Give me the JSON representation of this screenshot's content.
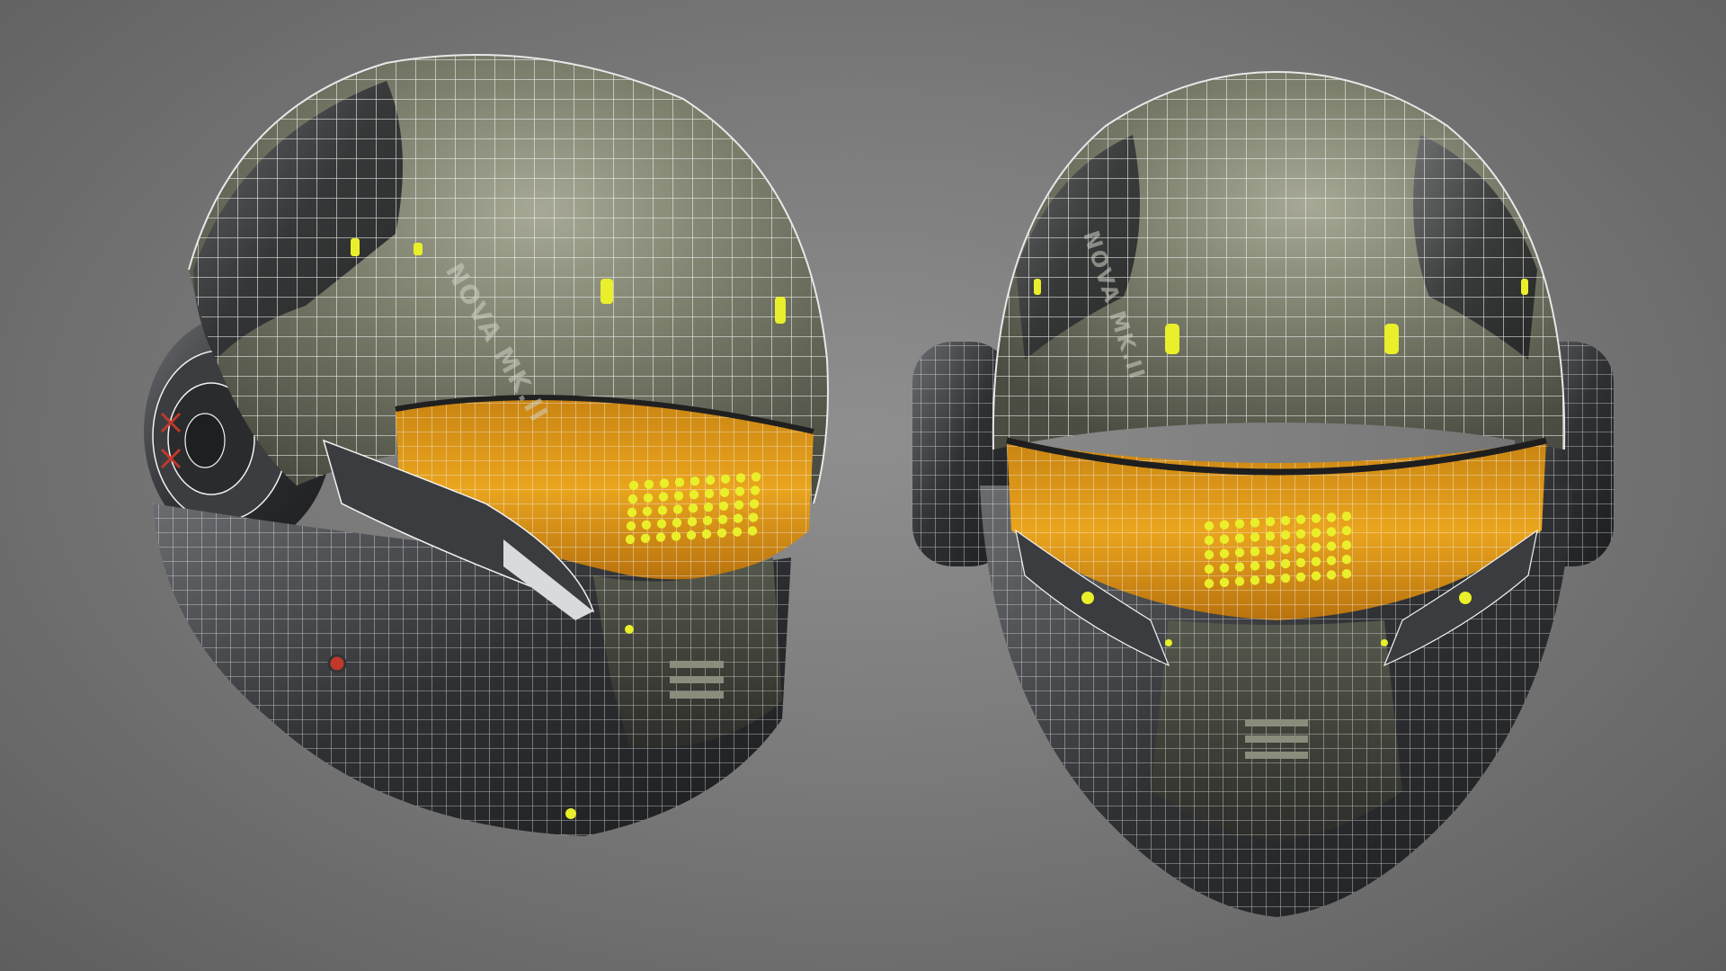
{
  "scene": {
    "background_color": "#7a7a7a",
    "wireframe_color": "#f2f2f2",
    "visor_color": "#e8a21a",
    "led_color": "#e9ef2a",
    "shell_color": "#6e7260",
    "metal_color": "#3a3c3e"
  },
  "helmets": [
    {
      "view": "three-quarter",
      "decal_text": "NOVA MK.II"
    },
    {
      "view": "front",
      "decal_text": "NOVA MK.II"
    }
  ]
}
